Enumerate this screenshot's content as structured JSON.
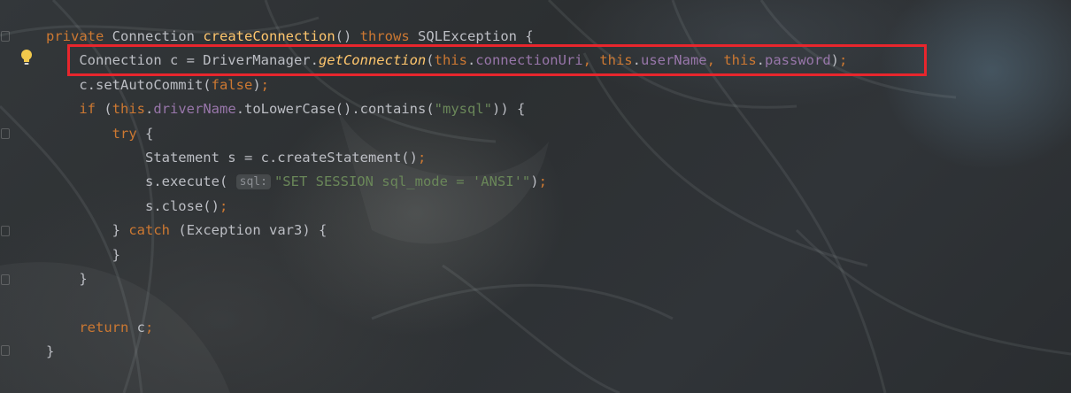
{
  "editor": {
    "code": {
      "line1": {
        "mod": "private",
        "type": "Connection",
        "method": "createConnection",
        "parens": "()",
        "throws": "throws",
        "exc": "SQLException {"
      },
      "line2": {
        "decl": "Connection c = DriverManager.",
        "call": "getConnection",
        "open": "(",
        "this1": "this",
        "f1": "connectionUri",
        "comma1": ",",
        "this2": "this",
        "f2": "userName",
        "comma2": ",",
        "this3": "this",
        "f3": "password",
        "close": ")",
        "semi": ";"
      },
      "line3": {
        "pre": "c.setAutoCommit(",
        "arg": "false",
        "post": ")",
        "semi": ";"
      },
      "line4": {
        "kw": "if",
        "open": "(",
        "this": "this",
        "field": "driverName",
        "mid": ".toLowerCase().contains(",
        "str": "\"mysql\"",
        "post": ")) {"
      },
      "line5": {
        "kw": "try",
        "post": "{"
      },
      "line6": {
        "text": "Statement s = c.createStatement()",
        "semi": ";"
      },
      "line7": {
        "pre": "s.execute(",
        "hint": "sql:",
        "str": "\"SET SESSION sql_mode = 'ANSI'\"",
        "post": ")",
        "semi": ";"
      },
      "line8": {
        "text": "s.close()",
        "semi": ";"
      },
      "line9": {
        "pre": "}",
        "kw": "catch",
        "post": "(Exception var3) {"
      },
      "line10": {
        "text": "}"
      },
      "line11": {
        "text": "}"
      },
      "line13": {
        "kw": "return",
        "text": "c",
        "semi": ";"
      },
      "line14": {
        "text": "}"
      }
    },
    "gutter": {
      "intention_icon": "lightbulb-icon",
      "fold_icon": "fold-marker-icon"
    },
    "annotation": {
      "highlight_color": "#e8262d"
    }
  }
}
